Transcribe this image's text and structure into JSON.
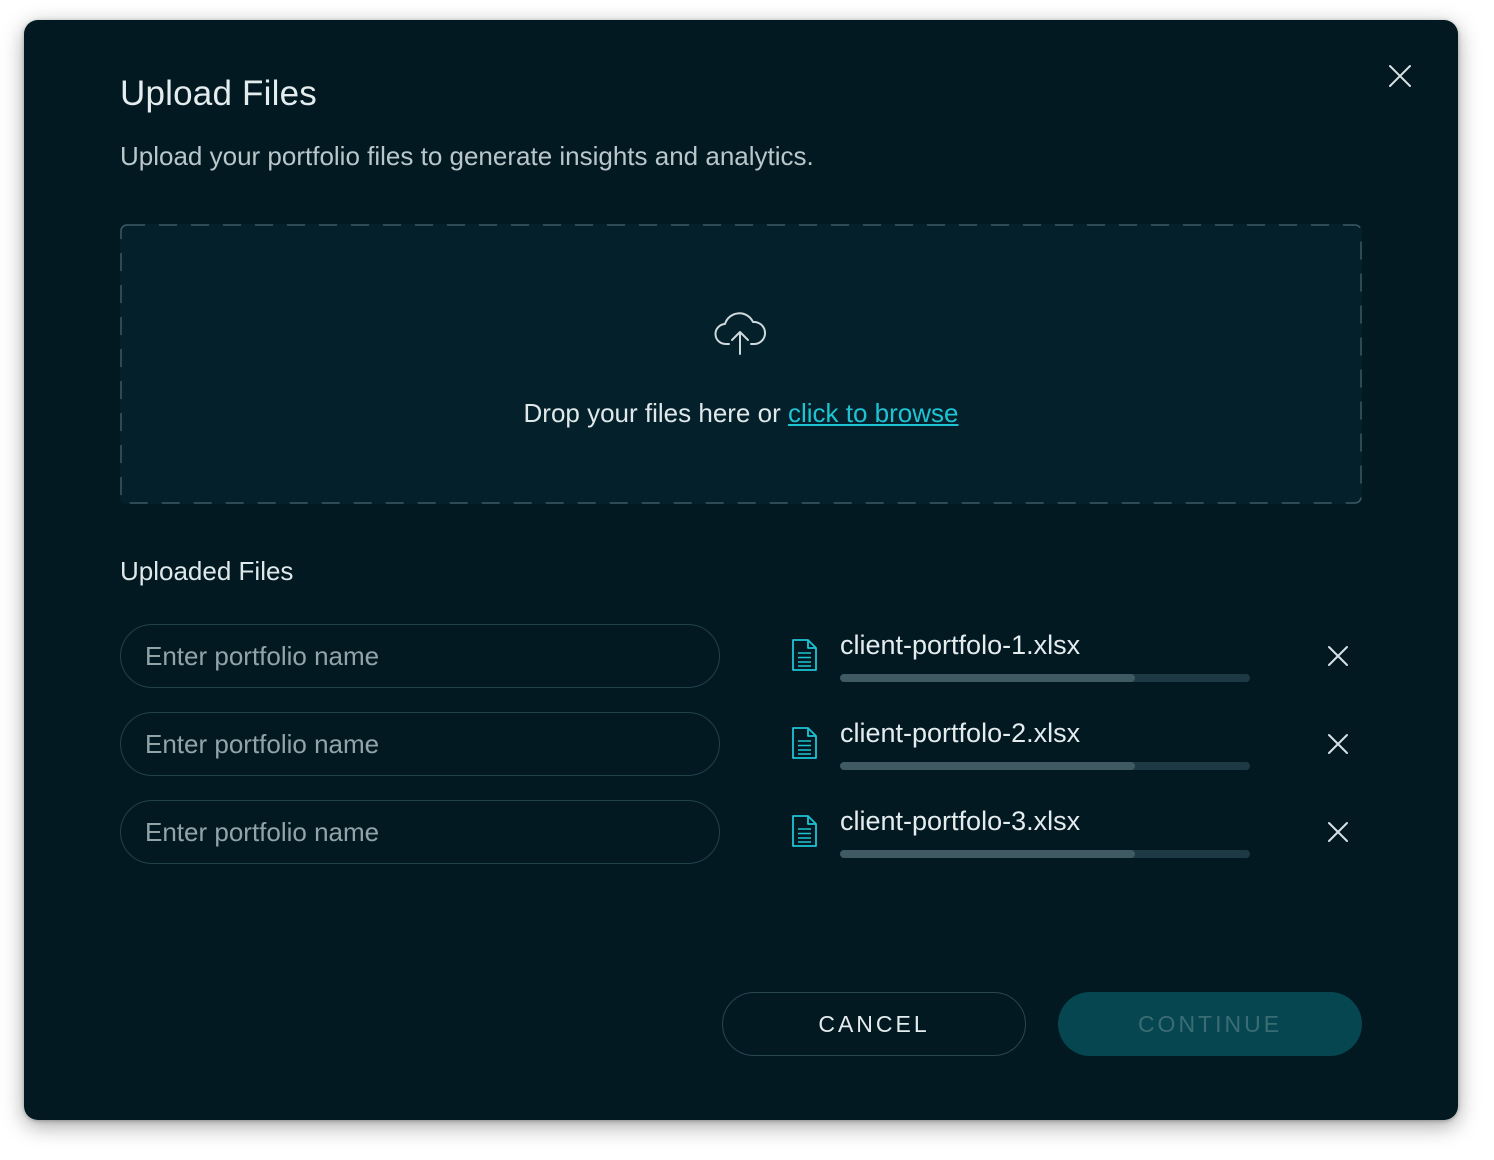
{
  "dialog": {
    "title": "Upload Files",
    "subtitle": "Upload your portfolio files to generate insights and analytics.",
    "close_icon": "close-icon"
  },
  "dropzone": {
    "icon": "cloud-upload-icon",
    "text": "Drop your files here or ",
    "link": "click to browse"
  },
  "uploaded": {
    "title": "Uploaded Files",
    "rows": [
      {
        "placeholder": "Enter portfolio name",
        "value": "",
        "file_name": "client-portfolo-1.xlsx",
        "progress": 0.72,
        "file_icon": "file-document-icon",
        "remove_icon": "close-icon"
      },
      {
        "placeholder": "Enter portfolio name",
        "value": "",
        "file_name": "client-portfolo-2.xlsx",
        "progress": 0.72,
        "file_icon": "file-document-icon",
        "remove_icon": "close-icon"
      },
      {
        "placeholder": "Enter portfolio name",
        "value": "",
        "file_name": "client-portfolo-3.xlsx",
        "progress": 0.72,
        "file_icon": "file-document-icon",
        "remove_icon": "close-icon"
      }
    ]
  },
  "actions": {
    "cancel_label": "CANCEL",
    "continue_label": "CONTINUE"
  },
  "colors": {
    "background": "#021922",
    "accent": "#1fc4d4",
    "continue_button": "#064650"
  }
}
